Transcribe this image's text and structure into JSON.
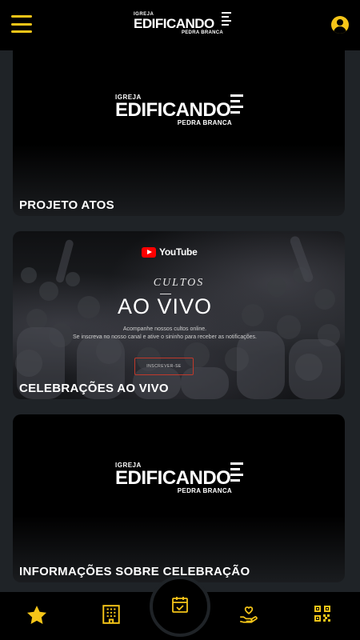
{
  "header": {
    "logo": {
      "top": "IGREJA",
      "main": "EDIFICANDO",
      "bottom": "PEDRA BRANCA"
    }
  },
  "cards": [
    {
      "title": "PROJETO ATOS"
    },
    {
      "title": "CELEBRAÇÕES AO VIVO",
      "youtube_label": "YouTube",
      "cultos": "CULTOS",
      "headline": "AO VIVO",
      "line1": "Acompanhe nossos cultos online.",
      "line2": "Se inscreva no nosso canal e ative o sininho para receber as notificações.",
      "button": "INSCREVER-SE"
    },
    {
      "title": "INFORMAÇÕES SOBRE CELEBRAÇÃO"
    }
  ],
  "bottom_nav": [
    {
      "icon": "star-icon"
    },
    {
      "icon": "building-icon"
    },
    {
      "icon": "calendar-check-icon"
    },
    {
      "icon": "hand-heart-icon"
    },
    {
      "icon": "qr-code-icon"
    }
  ],
  "colors": {
    "accent": "#f5c518",
    "background": "#1f2327",
    "bar": "#000000"
  }
}
